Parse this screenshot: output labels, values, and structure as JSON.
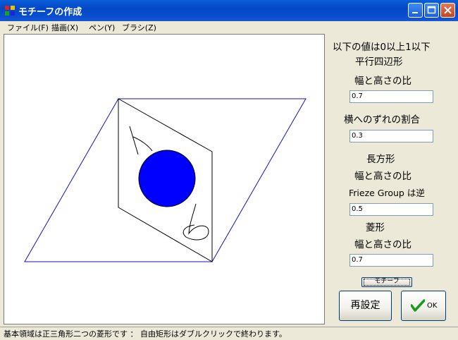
{
  "window": {
    "title": "モチーフの作成",
    "accent": "#0a4fd0"
  },
  "menu": [
    "ファイル(F)",
    "描画(X)",
    "ペン(Y)",
    "ブラシ(Z)"
  ],
  "side": {
    "header": "以下の値は0以上1以下",
    "parallelogram_title": "平行四辺形",
    "ratio_label_1": "幅と高さの比",
    "ratio_value_1": "0.7",
    "shift_label": "横へのずれの割合",
    "shift_value": "0.3",
    "rectangle_title": "長方形",
    "ratio_label_2": "幅と高さの比",
    "frieze_label": "Frieze Group は逆",
    "ratio_value_2": "0.5",
    "rhombus_title": "菱形",
    "ratio_label_3": "幅と高さの比",
    "ratio_value_3": "0.7",
    "motif_button": "モチーフ",
    "reset_button": "再設定",
    "ok_button": "OK"
  },
  "status": "基本領域は正三角形二つの菱形です ： 自由矩形はダブルクリックで終わります。",
  "colors": {
    "rhombus_outline": "#1010c0",
    "fill_circle": "#0000ff"
  }
}
